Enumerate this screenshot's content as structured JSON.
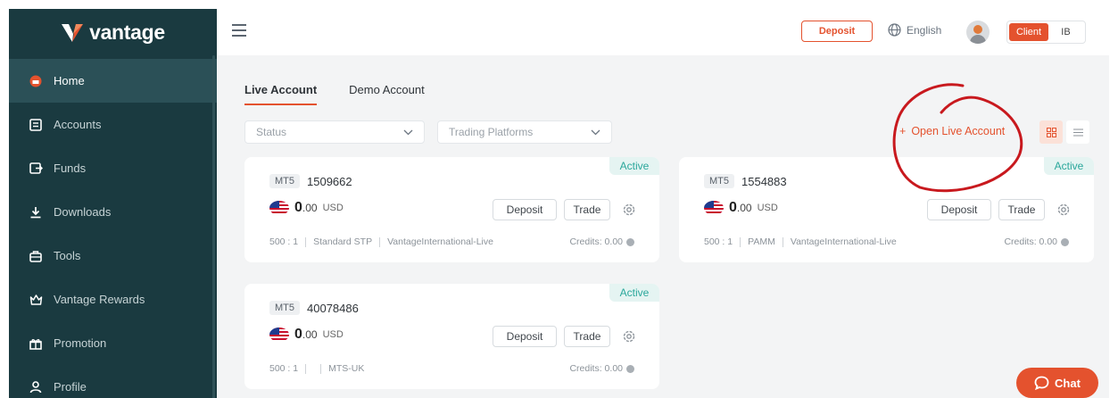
{
  "brand": {
    "name": "vantage",
    "logo_icon": "vantage-v-logo",
    "accent": "#e4522e",
    "sidebar_bg": "#1a3a40"
  },
  "sidebar": {
    "items": [
      {
        "label": "Home",
        "icon": "home-icon",
        "active": true
      },
      {
        "label": "Accounts",
        "icon": "accounts-icon",
        "active": false
      },
      {
        "label": "Funds",
        "icon": "funds-icon",
        "active": false
      },
      {
        "label": "Downloads",
        "icon": "download-icon",
        "active": false
      },
      {
        "label": "Tools",
        "icon": "tools-icon",
        "active": false
      },
      {
        "label": "Vantage Rewards",
        "icon": "rewards-icon",
        "active": false
      },
      {
        "label": "Promotion",
        "icon": "gift-icon",
        "active": false
      },
      {
        "label": "Profile",
        "icon": "profile-icon",
        "active": false
      }
    ]
  },
  "topbar": {
    "deposit_label": "Deposit",
    "language": "English",
    "role_client": "Client",
    "role_ib": "IB"
  },
  "tabs": [
    {
      "label": "Live Account",
      "active": true
    },
    {
      "label": "Demo Account",
      "active": false
    }
  ],
  "filters": {
    "status": "Status",
    "platforms": "Trading Platforms"
  },
  "open_live_label": "Open Live Account",
  "accounts": [
    {
      "status": "Active",
      "platform": "MT5",
      "number": "1509662",
      "balance_int": "0",
      "balance_dec": ".00",
      "currency": "USD",
      "deposit": "Deposit",
      "trade": "Trade",
      "leverage": "500 : 1",
      "account_type": "Standard STP",
      "server": "VantageInternational-Live",
      "credits": "Credits: 0.00"
    },
    {
      "status": "Active",
      "platform": "MT5",
      "number": "1554883",
      "balance_int": "0",
      "balance_dec": ".00",
      "currency": "USD",
      "deposit": "Deposit",
      "trade": "Trade",
      "leverage": "500 : 1",
      "account_type": "PAMM",
      "server": "VantageInternational-Live",
      "credits": "Credits: 0.00"
    },
    {
      "status": "Active",
      "platform": "MT5",
      "number": "40078486",
      "balance_int": "0",
      "balance_dec": ".00",
      "currency": "USD",
      "deposit": "Deposit",
      "trade": "Trade",
      "leverage": "500 : 1",
      "account_type": "",
      "server": "MTS-UK",
      "credits": "Credits: 0.00"
    }
  ],
  "chat_label": "Chat"
}
